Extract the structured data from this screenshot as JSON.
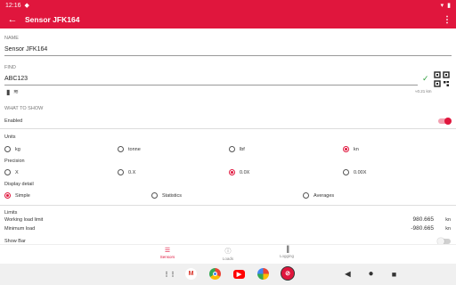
{
  "status": {
    "time": "12:16"
  },
  "appbar": {
    "title": "Sensor JFK164"
  },
  "name_section": {
    "label": "NAME",
    "value": "Sensor JFK164"
  },
  "find_section": {
    "label": "FIND",
    "value": "ABC123",
    "distance": "≈0.21 km"
  },
  "show_section": {
    "label": "WHAT TO SHOW",
    "enabled_label": "Enabled"
  },
  "units": {
    "label": "Units",
    "options": [
      "kg",
      "tonne",
      "lbf",
      "kn"
    ]
  },
  "precision": {
    "label": "Precision",
    "options": [
      "X",
      "0.X",
      "0.0X",
      "0.00X"
    ]
  },
  "display_detail": {
    "label": "Display detail",
    "options": [
      "Simple",
      "Statistics",
      "Averages"
    ]
  },
  "limits": {
    "label": "Limits",
    "working_label": "Working load limit",
    "working_value": "980.665",
    "working_unit": "kn",
    "minimum_label": "Minimum load",
    "minimum_value": "-980.665",
    "minimum_unit": "kn",
    "showbar_label": "Show Bar"
  },
  "bottomnav": {
    "sensors": "Sensors",
    "loads": "Loads",
    "logging": "Logging"
  },
  "colors": {
    "accent": "#e0163d"
  }
}
